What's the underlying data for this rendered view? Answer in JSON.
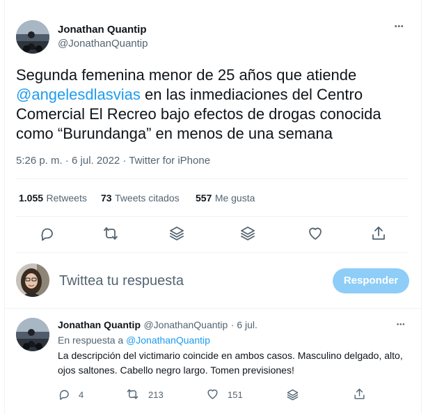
{
  "main_tweet": {
    "author_name": "Jonathan Quantip",
    "author_handle": "@JonathanQuantip",
    "more_label": "•••",
    "text_before": "Segunda femenina menor de 25 años que atiende ",
    "mention": "@angelesdlasvias",
    "text_after": " en las inmediaciones del Centro Comercial El Recreo bajo efectos de drogas conocida como “Burundanga” en menos de una semana",
    "timestamp": "5:26 p. m. · 6 jul. 2022 · Twitter for iPhone",
    "stats": {
      "retweets_count": "1.055",
      "retweets_label": "Retweets",
      "quotes_count": "73",
      "quotes_label": "Tweets citados",
      "likes_count": "557",
      "likes_label": "Me gusta"
    }
  },
  "reply_composer": {
    "placeholder": "Twittea tu respuesta",
    "button_label": "Responder"
  },
  "reply_tweet": {
    "author_name": "Jonathan Quantip",
    "author_handle": "@JonathanQuantip",
    "date": "· 6 jul.",
    "more_label": "•••",
    "replying_to_label": "En respuesta a",
    "replying_to_handle": "@JonathanQuantip",
    "text": "La descripción del victimario coincide en ambos casos. Masculino delgado, alto, ojos saltones. Cabello negro largo. Tomen previsiones!",
    "reply_count": "4",
    "retweet_count": "213",
    "like_count": "151"
  },
  "colors": {
    "accent": "#1d9bf0",
    "button_disabled": "#8ecdf7",
    "secondary_text": "#536471"
  }
}
